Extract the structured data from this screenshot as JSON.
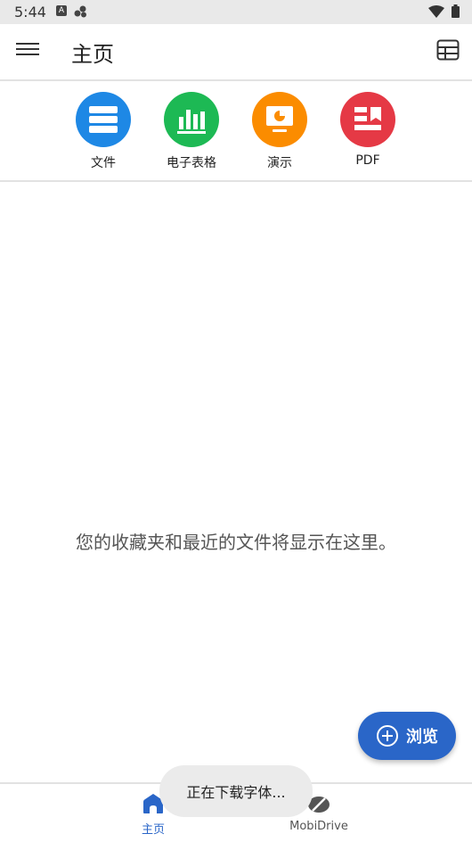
{
  "status_bar": {
    "time": "5:44",
    "a_badge": "A"
  },
  "app_bar": {
    "title": "主页"
  },
  "quick_access": [
    {
      "label": "文件",
      "icon": "documents-icon",
      "color": "#1E88E5"
    },
    {
      "label": "电子表格",
      "icon": "spreadsheet-icon",
      "color": "#1DB954"
    },
    {
      "label": "演示",
      "icon": "presentation-icon",
      "color": "#FB8C00"
    },
    {
      "label": "PDF",
      "icon": "pdf-icon",
      "color": "#E53945"
    }
  ],
  "empty_state": {
    "text": "您的收藏夹和最近的文件将显示在这里。"
  },
  "fab": {
    "label": "浏览",
    "color": "#2A66C8"
  },
  "bottom_nav": {
    "home": {
      "label": "主页",
      "active_color": "#2A66C8"
    },
    "drive": {
      "label": "MobiDrive"
    }
  },
  "toast": {
    "text": "正在下载字体..."
  }
}
